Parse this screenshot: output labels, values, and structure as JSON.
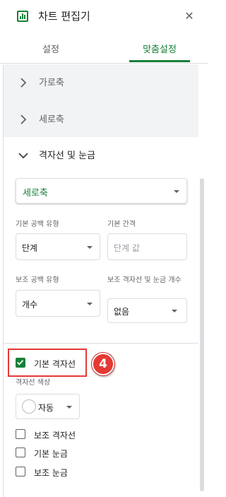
{
  "header": {
    "title": "차트 편집기",
    "close_glyph": "✕",
    "icon": "chart-icon"
  },
  "tabs": [
    {
      "label": "설정",
      "active": false
    },
    {
      "label": "맞춤설정",
      "active": true
    }
  ],
  "sections": {
    "horizontal_axis": "가로축",
    "vertical_axis": "세로축",
    "gridlines_ticks": "격자선 및 눈금"
  },
  "axis_select": {
    "value": "세로축"
  },
  "fields": {
    "major_spacing_type_label": "기본 공백 유형",
    "major_spacing_type_value": "단계",
    "major_step_label": "기본 간격",
    "major_step_placeholder": "단계 값",
    "minor_spacing_type_label": "보조 공백 유형",
    "minor_spacing_type_value": "개수",
    "minor_gridlines_label": "보조 격자선 및 눈금 개수",
    "minor_gridlines_value": "없음"
  },
  "checkboxes": {
    "major_gridlines": {
      "label": "기본 격자선",
      "checked": true
    },
    "minor_gridlines": {
      "label": "보조 격자선",
      "checked": false
    },
    "major_ticks": {
      "label": "기본 눈금",
      "checked": false
    },
    "minor_ticks": {
      "label": "보조 눈금",
      "checked": false
    }
  },
  "gridline_color": {
    "label": "격자선 색상",
    "value": "자동"
  },
  "annotation": {
    "badge": "4"
  },
  "colors": {
    "accent": "#188038",
    "highlight": "#e53935"
  }
}
